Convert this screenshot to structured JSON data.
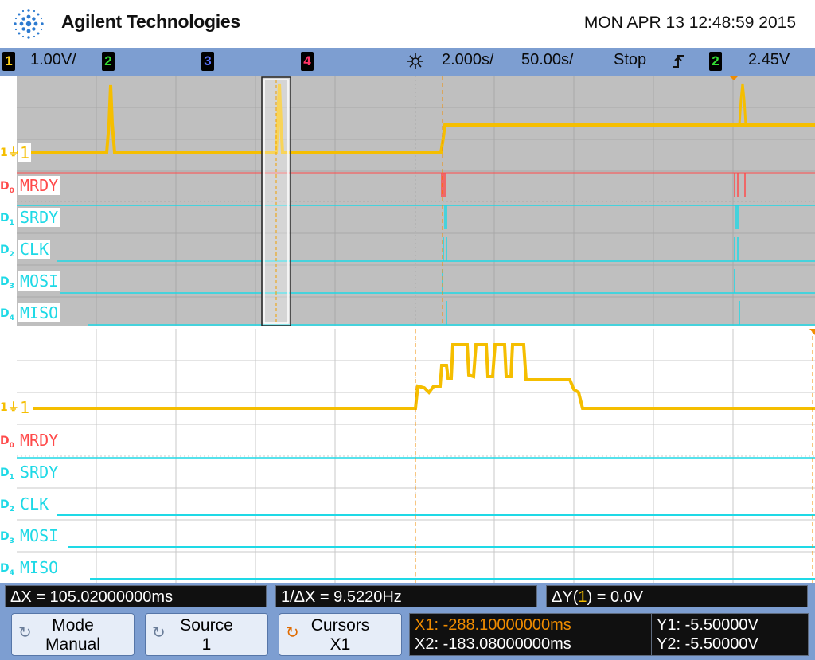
{
  "header": {
    "brand": "Agilent Technologies",
    "datetime": "MON APR 13 12:48:59 2015"
  },
  "status_bar": {
    "channels": [
      {
        "num": "1",
        "color": "#ffd21a",
        "scale": "1.00V/"
      },
      {
        "num": "2",
        "color": "#33dd33"
      },
      {
        "num": "3",
        "color": "#5a74ff"
      },
      {
        "num": "4",
        "color": "#ff3366"
      }
    ],
    "horiz_icon": "horizontal-delay-icon",
    "horiz_scale": "2.000s/",
    "zoom_scale": "50.00s/",
    "run_state": "Stop",
    "trigger_icon": "trigger-edge-icon",
    "trigger_source": "2",
    "trigger_level": "2.45V"
  },
  "colors": {
    "analog": "#f5be00",
    "mrdy": "#ff4a4a",
    "digital": "#1ed9e6",
    "grid_upper": "#a9a9a9",
    "grid_lower": "#c8c8c8",
    "statusbar": "#7d9ed1"
  },
  "upper_screen": {
    "channel_labels": {
      "analog": "1",
      "d0": "MRDY",
      "d1": "SRDY",
      "d2": "CLK",
      "d3": "MOSI",
      "d4": "MISO"
    }
  },
  "lower_screen": {
    "channel_labels": {
      "analog": "1",
      "d0": "MRDY",
      "d1": "SRDY",
      "d2": "CLK",
      "d3": "MOSI",
      "d4": "MISO"
    }
  },
  "digital_side": [
    "D0",
    "D1",
    "D2",
    "D3",
    "D4"
  ],
  "readouts": {
    "delta_x": "ΔX = 105.02000000ms",
    "inv_delta_x": "1/ΔX = 9.5220Hz",
    "delta_y_prefix": "ΔY(",
    "delta_y_channel": "1",
    "delta_y_suffix": ") = 0.0V"
  },
  "softkeys": [
    {
      "title": "Mode",
      "value": "Manual"
    },
    {
      "title": "Source",
      "value": "1"
    },
    {
      "title": "Cursors",
      "value": "X1"
    }
  ],
  "cursors": {
    "x1": "X1: -288.10000000ms",
    "x2": "X2: -183.08000000ms",
    "y1": "Y1: -5.50000V",
    "y2": "Y2: -5.50000V"
  }
}
